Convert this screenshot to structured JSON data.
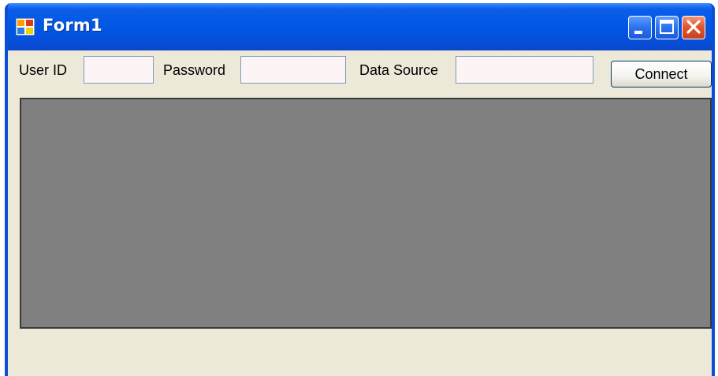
{
  "window": {
    "title": "Form1",
    "icon": "form-app-icon",
    "controls": [
      "minimize-icon",
      "maximize-icon",
      "close-icon"
    ]
  },
  "form": {
    "user_id_label": "User ID",
    "user_id_value": "",
    "password_label": "Password",
    "password_value": "",
    "data_source_label": "Data Source",
    "data_source_value": "",
    "connect_label": "Connect"
  },
  "colors": {
    "titlebar": "#0058e6",
    "client_background": "#ece9d8",
    "grid_background": "#808080",
    "textbox_background": "#fdf5f5",
    "close_button": "#e2562e"
  }
}
